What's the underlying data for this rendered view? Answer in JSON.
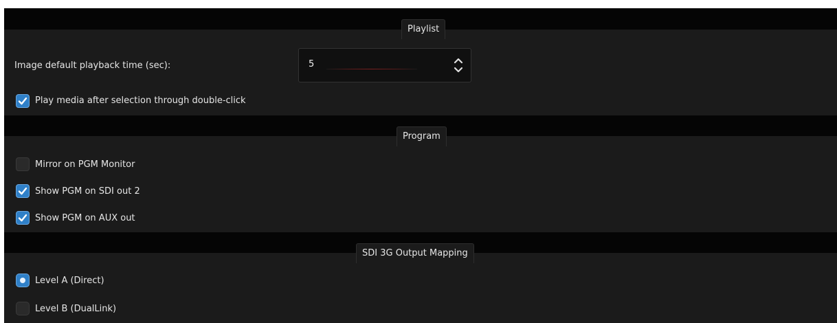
{
  "groups": {
    "playlist": {
      "title": "Playlist",
      "playback_time_label": "Image default playback time (sec):",
      "playback_time_value": "5",
      "double_click_label": "Play media after selection through double-click",
      "double_click_checked": true
    },
    "program": {
      "title": "Program",
      "items": [
        {
          "label": "Mirror on PGM Monitor",
          "checked": false
        },
        {
          "label": "Show PGM on SDI out 2",
          "checked": true
        },
        {
          "label": "Show PGM on AUX out",
          "checked": true
        }
      ]
    },
    "sdi_mapping": {
      "title": "SDI 3G Output Mapping",
      "options": [
        {
          "label": "Level A (Direct)",
          "selected": true
        },
        {
          "label": "Level B (DualLink)",
          "selected": false
        }
      ]
    }
  },
  "colors": {
    "panel_bg": "#1b1b1b",
    "band_bg": "#050505",
    "accent": "#2f80c8",
    "text": "#e6e6e6"
  },
  "icons": {
    "check": "checkmark-icon",
    "spin": "up-down-arrows-icon",
    "radio": "radio-dot-icon"
  }
}
